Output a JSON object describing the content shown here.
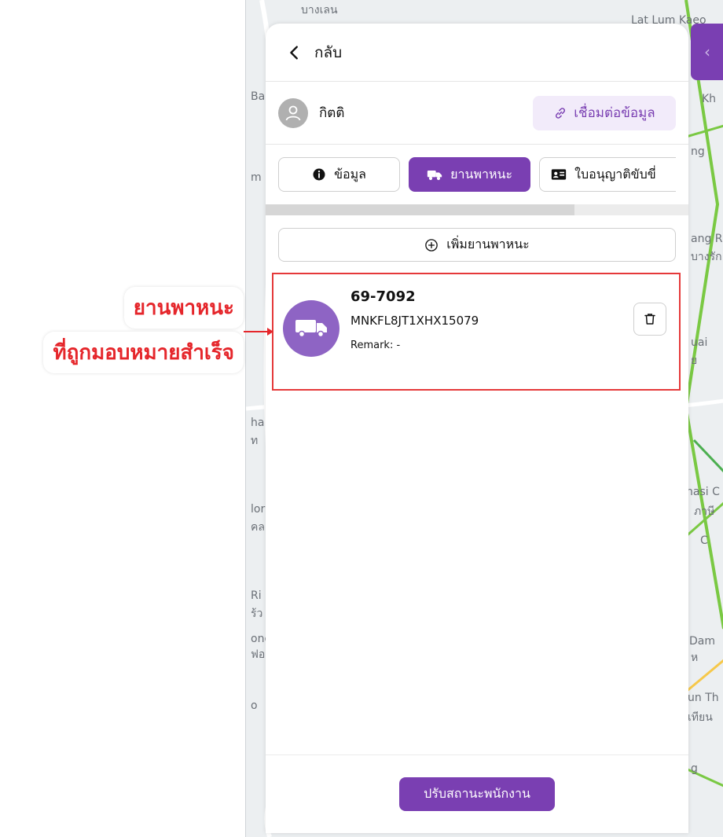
{
  "map": {
    "labels": [
      "Lat Lum Kaeo",
      "Kh",
      "ng",
      "ang R",
      "บางรัก",
      "uai",
      "ย",
      "hasi C",
      "ภาษี",
      "C",
      "Dam",
      "ห",
      "un Th",
      "เทียน",
      "g",
      "Ba",
      "m",
      "ha",
      "ท",
      "lor",
      "คล",
      "Ri",
      "ร้ว",
      "ong",
      "ฟอง",
      "o",
      "บางเลน"
    ]
  },
  "header": {
    "back_label": "กลับ"
  },
  "user": {
    "name": "กิตติ",
    "link_button_label": "เชื่อมต่อข้อมูล"
  },
  "tabs": [
    {
      "label": "ข้อมูล",
      "icon": "info-icon",
      "active": false
    },
    {
      "label": "ยานพาหนะ",
      "icon": "truck-icon",
      "active": true
    },
    {
      "label": "ใบอนุญาติขับขี่",
      "icon": "id-card-icon",
      "active": false
    }
  ],
  "progress": {
    "value": 0.73
  },
  "add_vehicle_label": "เพิ่มยานพาหนะ",
  "vehicle": {
    "plate": "69-7092",
    "vin": "MNKFL8JT1XHX15079",
    "remark": "Remark: -"
  },
  "footer": {
    "status_button_label": "ปรับสถานะพนักงาน"
  },
  "annotation": {
    "line1": "ยานพาหนะ",
    "line2": "ที่ถูกมอบหมายสำเร็จ"
  },
  "colors": {
    "accent": "#7a3fb2",
    "accent_light": "#f2ebfa",
    "alert_red": "#e5393a"
  }
}
